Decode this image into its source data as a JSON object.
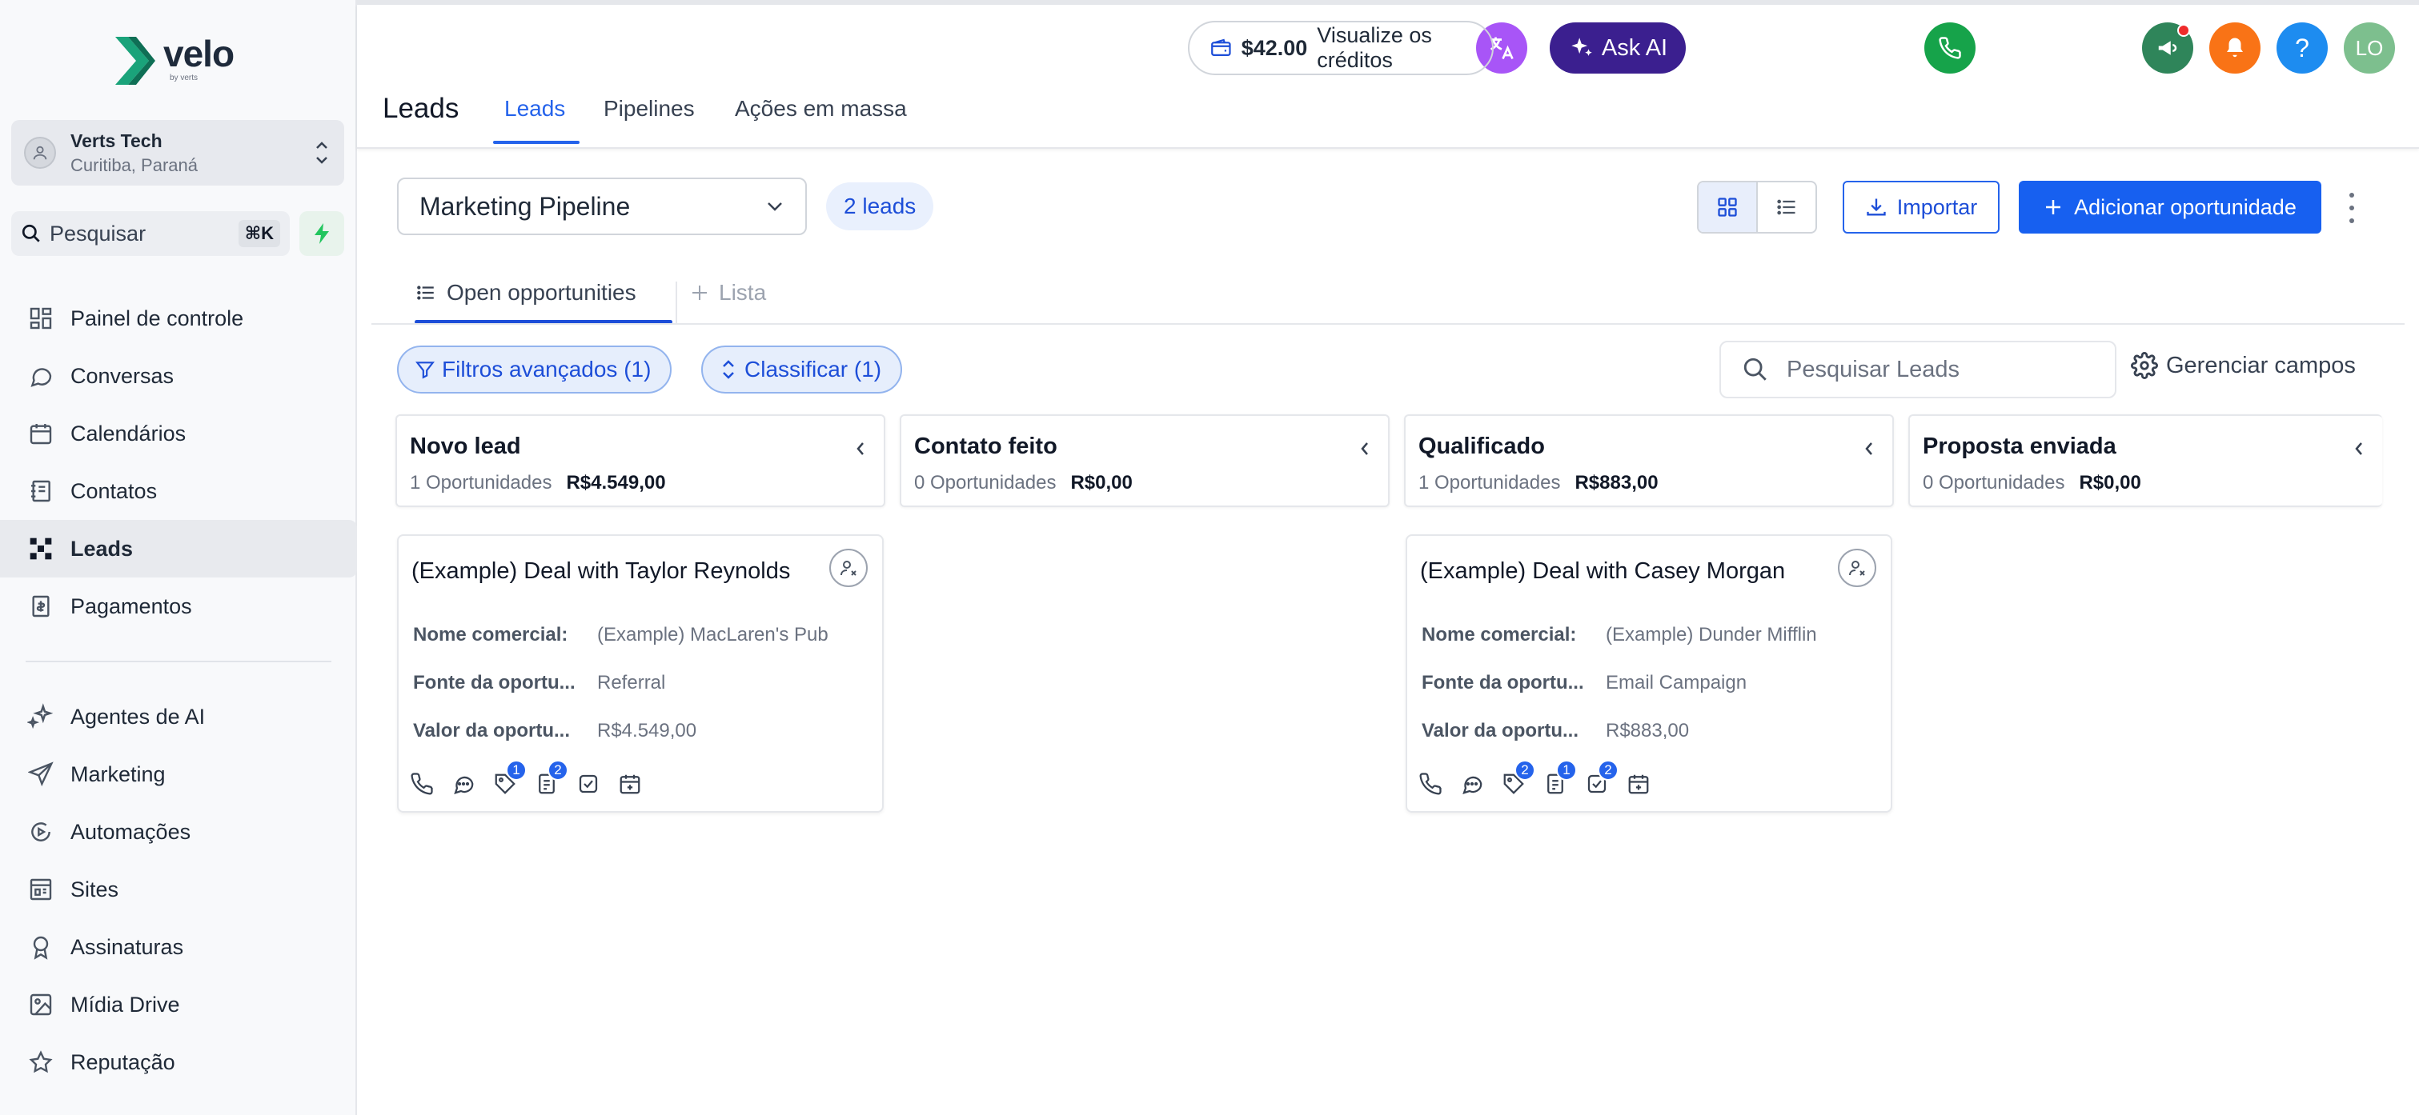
{
  "brand": {
    "name": "velo",
    "sub": "by verts"
  },
  "account": {
    "name": "Verts Tech",
    "location": "Curitiba, Paraná"
  },
  "sidebar": {
    "search_label": "Pesquisar",
    "search_shortcut": "⌘K",
    "items": [
      {
        "label": "Painel de controle",
        "icon": "dashboard-icon"
      },
      {
        "label": "Conversas",
        "icon": "chat-bubble-icon"
      },
      {
        "label": "Calendários",
        "icon": "calendar-icon"
      },
      {
        "label": "Contatos",
        "icon": "contacts-icon"
      },
      {
        "label": "Leads",
        "icon": "leads-icon",
        "active": true
      },
      {
        "label": "Pagamentos",
        "icon": "payments-icon"
      },
      {
        "label": "Agentes de AI",
        "icon": "sparkle-icon"
      },
      {
        "label": "Marketing",
        "icon": "send-icon"
      },
      {
        "label": "Automações",
        "icon": "automation-icon"
      },
      {
        "label": "Sites",
        "icon": "sites-icon"
      },
      {
        "label": "Assinaturas",
        "icon": "award-icon"
      },
      {
        "label": "Mídia Drive",
        "icon": "image-icon"
      },
      {
        "label": "Reputação",
        "icon": "star-icon"
      }
    ]
  },
  "header": {
    "title": "Leads",
    "tabs": [
      {
        "label": "Leads",
        "active": true
      },
      {
        "label": "Pipelines"
      },
      {
        "label": "Ações em massa"
      }
    ],
    "credits_amount": "$42.00",
    "credits_label": "Visualize os créditos",
    "ask_ai_label": "Ask AI",
    "help_label": "?",
    "avatar_initials": "LO"
  },
  "toolbar": {
    "pipeline_selected": "Marketing Pipeline",
    "leads_count": "2 leads",
    "import_label": "Importar",
    "add_label": "Adicionar oportunidade"
  },
  "subtabs": [
    {
      "label": "Open opportunities",
      "active": true
    },
    {
      "label": "Lista"
    }
  ],
  "filters": {
    "advanced": "Filtros avançados (1)",
    "sort": "Classificar (1)",
    "search_placeholder": "Pesquisar Leads",
    "manage_fields": "Gerenciar campos"
  },
  "columns": [
    {
      "title": "Novo lead",
      "count": "1 Oportunidades",
      "total": "R$4.549,00"
    },
    {
      "title": "Contato feito",
      "count": "0 Oportunidades",
      "total": "R$0,00"
    },
    {
      "title": "Qualificado",
      "count": "1 Oportunidades",
      "total": "R$883,00"
    },
    {
      "title": "Proposta enviada",
      "count": "0 Oportunidades",
      "total": "R$0,00"
    }
  ],
  "cards": [
    {
      "title": "(Example) Deal with Taylor Reynolds",
      "rows": [
        {
          "key": "Nome comercial:",
          "value": "(Example) MacLaren's Pub"
        },
        {
          "key": "Fonte da oportu...",
          "value": "Referral"
        },
        {
          "key": "Valor da oportu...",
          "value": "R$4.549,00"
        }
      ],
      "badges": {
        "tags": "1",
        "notes": "2",
        "tasks": ""
      }
    },
    {
      "title": "(Example) Deal with Casey Morgan",
      "rows": [
        {
          "key": "Nome comercial:",
          "value": "(Example) Dunder Mifflin"
        },
        {
          "key": "Fonte da oportu...",
          "value": "Email Campaign"
        },
        {
          "key": "Valor da oportu...",
          "value": "R$883,00"
        }
      ],
      "badges": {
        "tags": "2",
        "notes": "1",
        "tasks": "2"
      }
    }
  ],
  "colors": {
    "primary": "#1760f0",
    "ask_ai": "#3b1f8f",
    "phone": "#16a34a",
    "notify": "#f97316",
    "help": "#1d8cf0",
    "avatar": "#7dbf8e",
    "translate": "#a855f7"
  }
}
